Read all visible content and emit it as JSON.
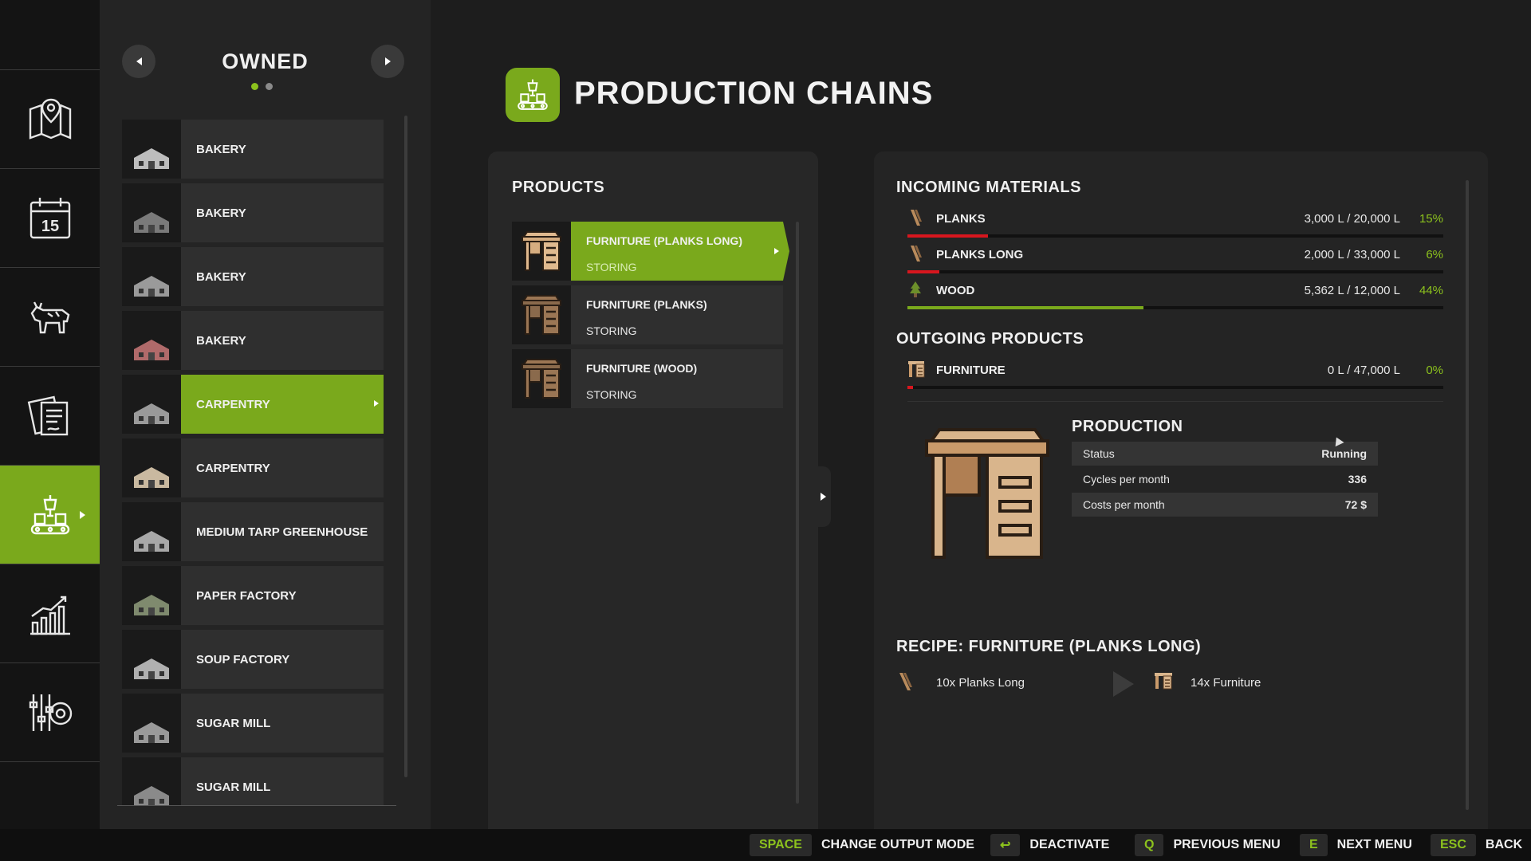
{
  "sidebar": {
    "icons": [
      "map-icon",
      "calendar-icon",
      "animals-icon",
      "contracts-icon",
      "production-icon",
      "statistics-icon",
      "settings-icon"
    ],
    "calendar_day": "15",
    "active_index": 4
  },
  "owned": {
    "title": "OWNED",
    "page_dots": 2,
    "active_dot": 0,
    "items": [
      {
        "label": "BAKERY",
        "selected": false
      },
      {
        "label": "BAKERY",
        "selected": false
      },
      {
        "label": "BAKERY",
        "selected": false
      },
      {
        "label": "BAKERY",
        "selected": false
      },
      {
        "label": "CARPENTRY",
        "selected": true
      },
      {
        "label": "CARPENTRY",
        "selected": false
      },
      {
        "label": "MEDIUM TARP GREENHOUSE",
        "selected": false
      },
      {
        "label": "PAPER FACTORY",
        "selected": false
      },
      {
        "label": "SOUP FACTORY",
        "selected": false
      },
      {
        "label": "SUGAR MILL",
        "selected": false
      },
      {
        "label": "SUGAR MILL",
        "selected": false
      }
    ]
  },
  "header": {
    "title": "PRODUCTION CHAINS"
  },
  "products": {
    "title": "PRODUCTS",
    "items": [
      {
        "name": "FURNITURE (PLANKS LONG)",
        "status": "STORING",
        "selected": true
      },
      {
        "name": "FURNITURE (PLANKS)",
        "status": "STORING",
        "selected": false
      },
      {
        "name": "FURNITURE (WOOD)",
        "status": "STORING",
        "selected": false
      }
    ]
  },
  "incoming": {
    "title": "INCOMING MATERIALS",
    "items": [
      {
        "name": "PLANKS",
        "amount": "3,000 L / 20,000 L",
        "percent": "15%",
        "fill": 0.15,
        "color": "#d7161e",
        "icon": "planks-icon"
      },
      {
        "name": "PLANKS LONG",
        "amount": "2,000 L / 33,000 L",
        "percent": "6%",
        "fill": 0.06,
        "color": "#d7161e",
        "icon": "planks-long-icon"
      },
      {
        "name": "WOOD",
        "amount": "5,362 L / 12,000 L",
        "percent": "44%",
        "fill": 0.44,
        "color": "#7aa91c",
        "icon": "wood-icon"
      }
    ]
  },
  "outgoing": {
    "title": "OUTGOING PRODUCTS",
    "items": [
      {
        "name": "FURNITURE",
        "amount": "0 L / 47,000 L",
        "percent": "0%",
        "fill": 0.0,
        "color": "#d7161e",
        "icon": "furniture-icon"
      }
    ]
  },
  "production": {
    "title": "PRODUCTION",
    "stats": [
      {
        "label": "Status",
        "value": "Running"
      },
      {
        "label": "Cycles per month",
        "value": "336"
      },
      {
        "label": "Costs per month",
        "value": "72 $"
      }
    ]
  },
  "recipe": {
    "title": "RECIPE: FURNITURE (PLANKS LONG)",
    "input": "10x Planks Long",
    "output": "14x Furniture"
  },
  "bottom_bar": {
    "hints": [
      {
        "key": "SPACE",
        "action": "CHANGE OUTPUT MODE"
      },
      {
        "key": "↩",
        "action": "DEACTIVATE"
      },
      {
        "key": "Q",
        "action": "PREVIOUS MENU"
      },
      {
        "key": "E",
        "action": "NEXT MENU"
      },
      {
        "key": "ESC",
        "action": "BACK"
      }
    ]
  },
  "colors": {
    "accent": "#7aa91c",
    "percent_text": "#8cc21d",
    "low_fill": "#d7161e"
  }
}
